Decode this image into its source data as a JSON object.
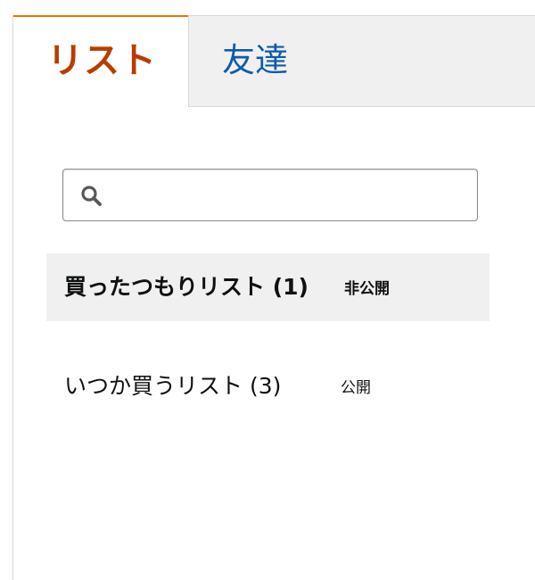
{
  "tabs": [
    {
      "label": "リスト",
      "active": true
    },
    {
      "label": "友達",
      "active": false
    }
  ],
  "search": {
    "value": "",
    "placeholder": ""
  },
  "lists": [
    {
      "name": "買ったつもりリスト (1)",
      "privacy": "非公開",
      "selected": true
    },
    {
      "name": "いつか買うリスト (3)",
      "privacy": "公開",
      "selected": false
    }
  ],
  "colors": {
    "active_tab_text": "#b83c00",
    "active_tab_border": "#e77600",
    "inactive_tab_text": "#0f5ba8",
    "inactive_tab_bg": "#f0f0f0",
    "selected_item_bg": "#f0f0f0"
  },
  "icons": {
    "search": "search-icon"
  }
}
